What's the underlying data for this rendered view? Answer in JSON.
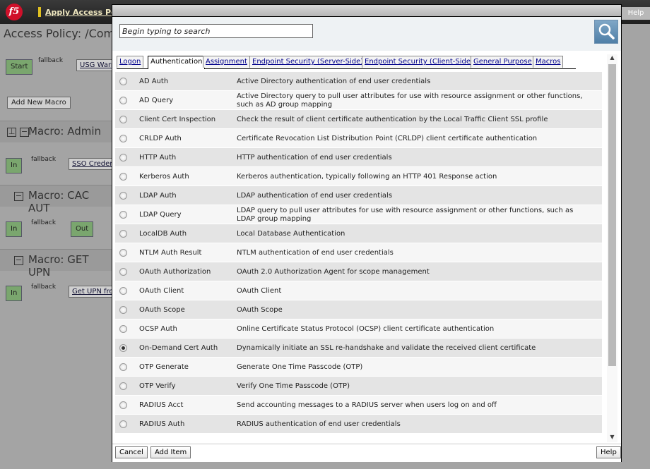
{
  "header": {
    "logo": "f5",
    "apply_link": "Apply Access Polic",
    "help": "Help"
  },
  "background": {
    "title": "Access Policy: /Comm",
    "start_label": "Start",
    "fallback_label": "fallback",
    "usg_link": "USG Warn",
    "add_macro": "Add New Macro",
    "macros": [
      {
        "title": "Macro: Admin",
        "in": "In",
        "link": "SSO Creden"
      },
      {
        "title": "Macro: CAC AUT",
        "in": "In",
        "out": "Out"
      },
      {
        "title": "Macro: GET UPN",
        "in": "In",
        "link": "Get UPN from"
      }
    ]
  },
  "dialog": {
    "search_placeholder": "Begin typing to search",
    "tabs": [
      {
        "label": "Logon"
      },
      {
        "label": "Authentication"
      },
      {
        "label": "Assignment"
      },
      {
        "label": "Endpoint Security (Server-Side)"
      },
      {
        "label": "Endpoint Security (Client-Side)"
      },
      {
        "label": "General Purpose"
      },
      {
        "label": "Macros"
      }
    ],
    "active_tab": "Authentication",
    "items": [
      {
        "name": "AD Auth",
        "desc": "Active Directory authentication of end user credentials"
      },
      {
        "name": "AD Query",
        "desc": "Active Directory query to pull user attributes for use with resource assignment or other functions, such as AD group mapping"
      },
      {
        "name": "Client Cert Inspection",
        "desc": "Check the result of client certificate authentication by the Local Traffic Client SSL profile"
      },
      {
        "name": "CRLDP Auth",
        "desc": "Certificate Revocation List Distribution Point (CRLDP) client certificate authentication"
      },
      {
        "name": "HTTP Auth",
        "desc": "HTTP authentication of end user credentials"
      },
      {
        "name": "Kerberos Auth",
        "desc": "Kerberos authentication, typically following an HTTP 401 Response action"
      },
      {
        "name": "LDAP Auth",
        "desc": "LDAP authentication of end user credentials"
      },
      {
        "name": "LDAP Query",
        "desc": "LDAP query to pull user attributes for use with resource assignment or other functions, such as LDAP group mapping"
      },
      {
        "name": "LocalDB Auth",
        "desc": "Local Database Authentication"
      },
      {
        "name": "NTLM Auth Result",
        "desc": "NTLM authentication of end user credentials"
      },
      {
        "name": "OAuth Authorization",
        "desc": "OAuth 2.0 Authorization Agent for scope management"
      },
      {
        "name": "OAuth Client",
        "desc": "OAuth Client"
      },
      {
        "name": "OAuth Scope",
        "desc": "OAuth Scope"
      },
      {
        "name": "OCSP Auth",
        "desc": "Online Certificate Status Protocol (OCSP) client certificate authentication"
      },
      {
        "name": "On-Demand Cert Auth",
        "desc": "Dynamically initiate an SSL re-handshake and validate the received client certificate",
        "selected": true
      },
      {
        "name": "OTP Generate",
        "desc": "Generate One Time Passcode (OTP)"
      },
      {
        "name": "OTP Verify",
        "desc": "Verify One Time Passcode (OTP)"
      },
      {
        "name": "RADIUS Acct",
        "desc": "Send accounting messages to a RADIUS server when users log on and off"
      },
      {
        "name": "RADIUS Auth",
        "desc": "RADIUS authentication of end user credentials"
      }
    ],
    "buttons": {
      "cancel": "Cancel",
      "add_item": "Add Item",
      "help": "Help"
    }
  },
  "colors": {
    "accent": "#5a86ad",
    "node_green": "#7aa66e",
    "brand_red": "#d0102a"
  }
}
